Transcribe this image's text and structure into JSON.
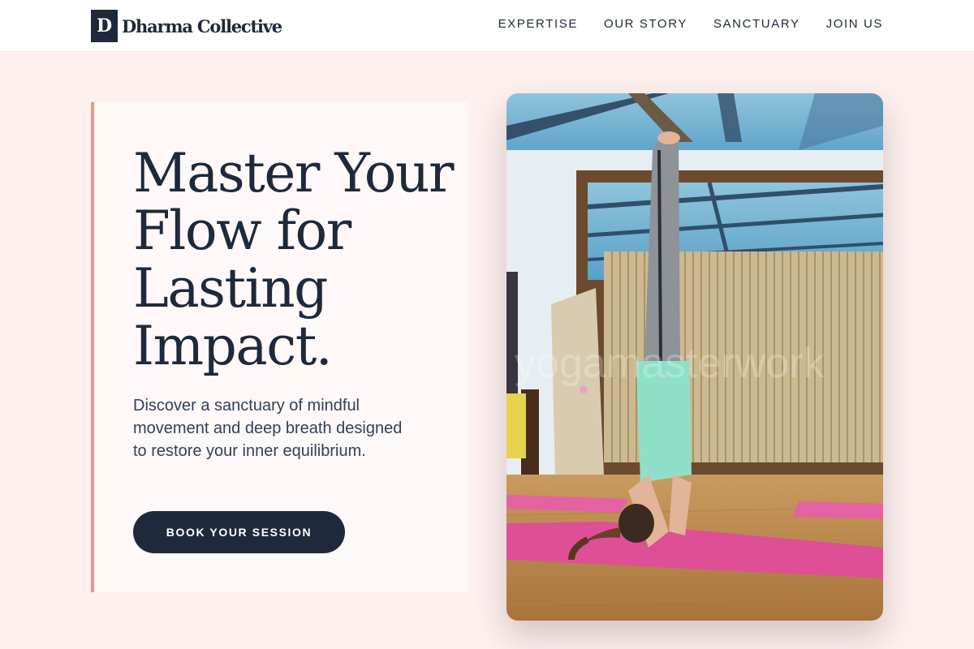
{
  "brand": {
    "mark": "D",
    "name": "Dharma Collective"
  },
  "nav": {
    "items": [
      "EXPERTISE",
      "OUR STORY",
      "SANCTUARY",
      "JOIN US"
    ]
  },
  "hero": {
    "title": "Master Your Flow for Lasting Impact.",
    "subtitle": "Discover a sanctuary of mindful movement and deep breath designed to restore your inner equilibrium.",
    "cta_label": "BOOK YOUR SESSION"
  },
  "photo": {
    "watermark": "yogamasterwork"
  },
  "colors": {
    "primary": "#1e293b",
    "accent": "#df9a88",
    "background": "#fdf0ef",
    "card": "#fff8f8"
  }
}
